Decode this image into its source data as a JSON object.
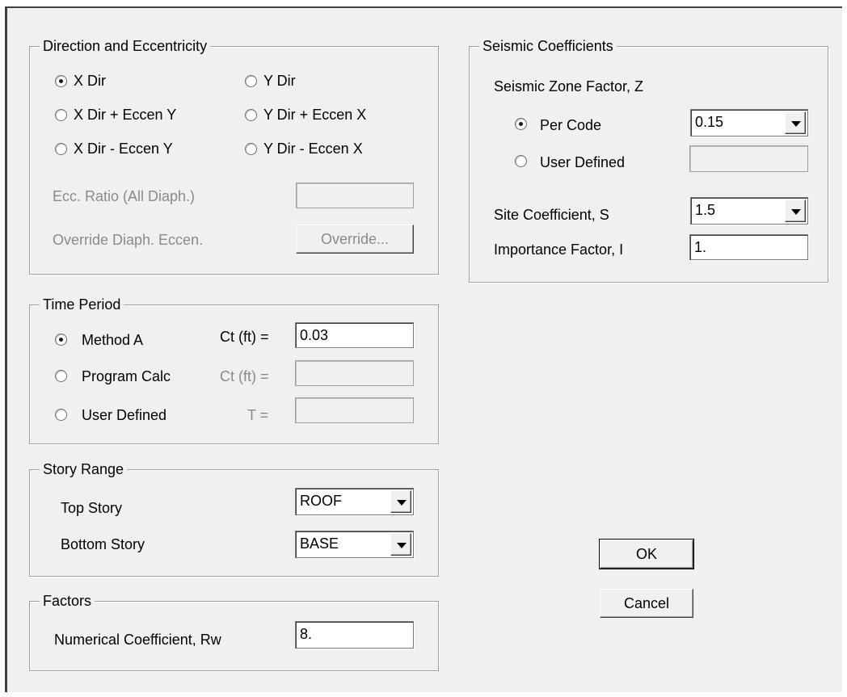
{
  "direction": {
    "title": "Direction and Eccentricity",
    "options": [
      {
        "label": "X  Dir",
        "checked": true
      },
      {
        "label": "Y  Dir",
        "checked": false
      },
      {
        "label": "X  Dir + Eccen Y",
        "checked": false
      },
      {
        "label": "Y  Dir + Eccen X",
        "checked": false
      },
      {
        "label": "X  Dir - Eccen Y",
        "checked": false
      },
      {
        "label": "Y  Dir - Eccen X",
        "checked": false
      }
    ],
    "ecc_ratio_label": "Ecc. Ratio (All Diaph.)",
    "ecc_ratio_value": "",
    "override_label": "Override Diaph. Eccen.",
    "override_button": "Override..."
  },
  "time_period": {
    "title": "Time Period",
    "method_a": {
      "label": "Method A",
      "field_label": "Ct (ft) =",
      "value": "0.03",
      "checked": true
    },
    "program_calc": {
      "label": "Program Calc",
      "field_label": "Ct (ft) =",
      "value": "",
      "checked": false
    },
    "user_defined": {
      "label": "User Defined",
      "field_label": "T =",
      "value": "",
      "checked": false
    }
  },
  "story_range": {
    "title": "Story Range",
    "top_label": "Top Story",
    "top_value": "ROOF",
    "bottom_label": "Bottom Story",
    "bottom_value": "BASE"
  },
  "factors": {
    "title": "Factors",
    "rw_label": "Numerical Coefficient, Rw",
    "rw_value": "8."
  },
  "seismic": {
    "title": "Seismic Coefficients",
    "zone_label": "Seismic Zone Factor, Z",
    "per_code_label": "Per Code",
    "per_code_value": "0.15",
    "per_code_checked": true,
    "user_defined_label": "User Defined",
    "user_defined_value": "",
    "site_label": "Site Coefficient, S",
    "site_value": "1.5",
    "importance_label": "Importance Factor, I",
    "importance_value": "1."
  },
  "buttons": {
    "ok": "OK",
    "cancel": "Cancel"
  }
}
